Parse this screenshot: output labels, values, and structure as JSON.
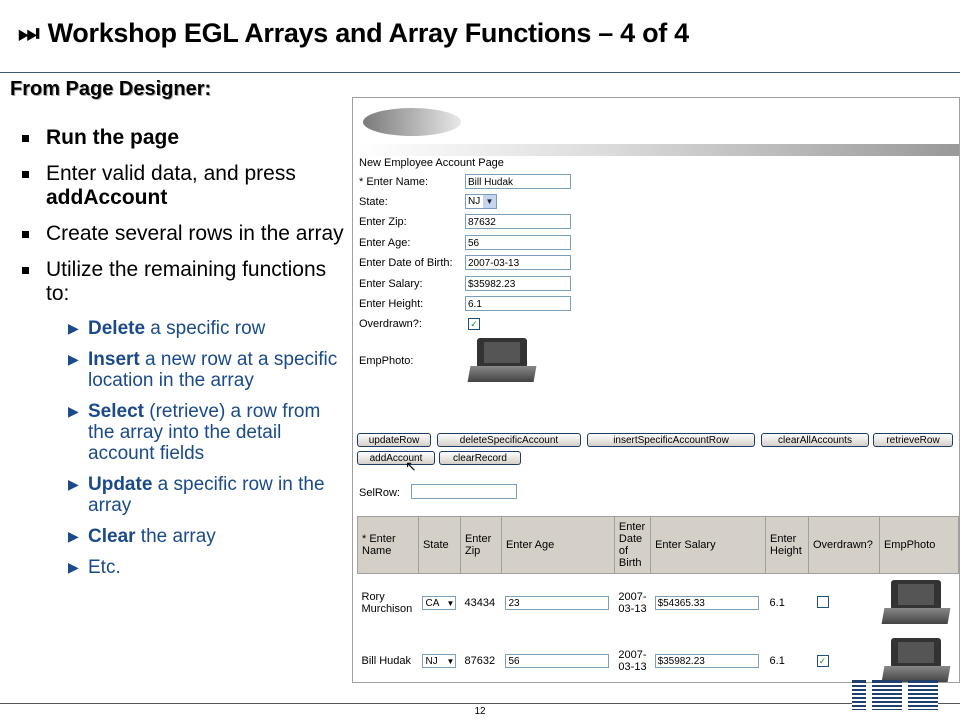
{
  "title_icon": "⏭",
  "title": "Workshop EGL Arrays and Array Functions   – 4 of 4",
  "subtitle": "From Page Designer:",
  "bullets": {
    "b1": "Run the page",
    "b2_pre": "Enter valid data, and press ",
    "b2_bold": "addAccount",
    "b3": "Create several rows in the array",
    "b4": "Utilize the remaining functions to:",
    "s1_bold": "Delete",
    "s1_rest": " a specific row",
    "s2_bold": "Insert",
    "s2_rest": " a new row at a specific location in the array",
    "s3_bold": "Select",
    "s3_rest": " (retrieve) a row from the array into the detail account fields",
    "s4_bold": "Update",
    "s4_rest": " a specific row in the array",
    "s5_bold": "Clear",
    "s5_rest": " the array",
    "s6": "Etc."
  },
  "screen": {
    "page_name": "New Employee Account Page",
    "labels": {
      "name": "* Enter Name:",
      "state": "State:",
      "zip": "Enter Zip:",
      "age": "Enter Age:",
      "dob": "Enter Date of Birth:",
      "salary": "Enter Salary:",
      "height": "Enter Height:",
      "overdrawn": "Overdrawn?:",
      "photo": "EmpPhoto:",
      "selrow": "SelRow:"
    },
    "values": {
      "name": "Bill Hudak",
      "state": "NJ",
      "zip": "87632",
      "age": "56",
      "dob": "2007-03-13",
      "salary": "$35982.23",
      "height": "6.1",
      "overdrawn": "✓",
      "selrow": ""
    },
    "buttons": {
      "updateRow": "updateRow",
      "deleteSpecificAccount": "deleteSpecificAccount",
      "insertSpecificAccountRow": "insertSpecificAccountRow",
      "clearAllAccounts": "clearAllAccounts",
      "retrieveRow": "retrieveRow",
      "addAccount": "addAccount",
      "clearRecord": "clearRecord"
    },
    "table": {
      "headers": [
        "* Enter Name",
        "State",
        "Enter Zip",
        "Enter Age",
        "Enter Date of Birth",
        "Enter Salary",
        "Enter Height",
        "Overdrawn?",
        "EmpPhoto"
      ],
      "rows": [
        {
          "name": "Rory Murchison",
          "state": "CA",
          "zip": "43434",
          "age": "23",
          "dob": "2007-03-13",
          "salary": "$54365.33",
          "height": "6.1",
          "overdrawn": ""
        },
        {
          "name": "Bill Hudak",
          "state": "NJ",
          "zip": "87632",
          "age": "56",
          "dob": "2007-03-13",
          "salary": "$35982.23",
          "height": "6.1",
          "overdrawn": "✓"
        }
      ]
    }
  },
  "footer": {
    "page_number": "12",
    "logo": "IBM"
  }
}
